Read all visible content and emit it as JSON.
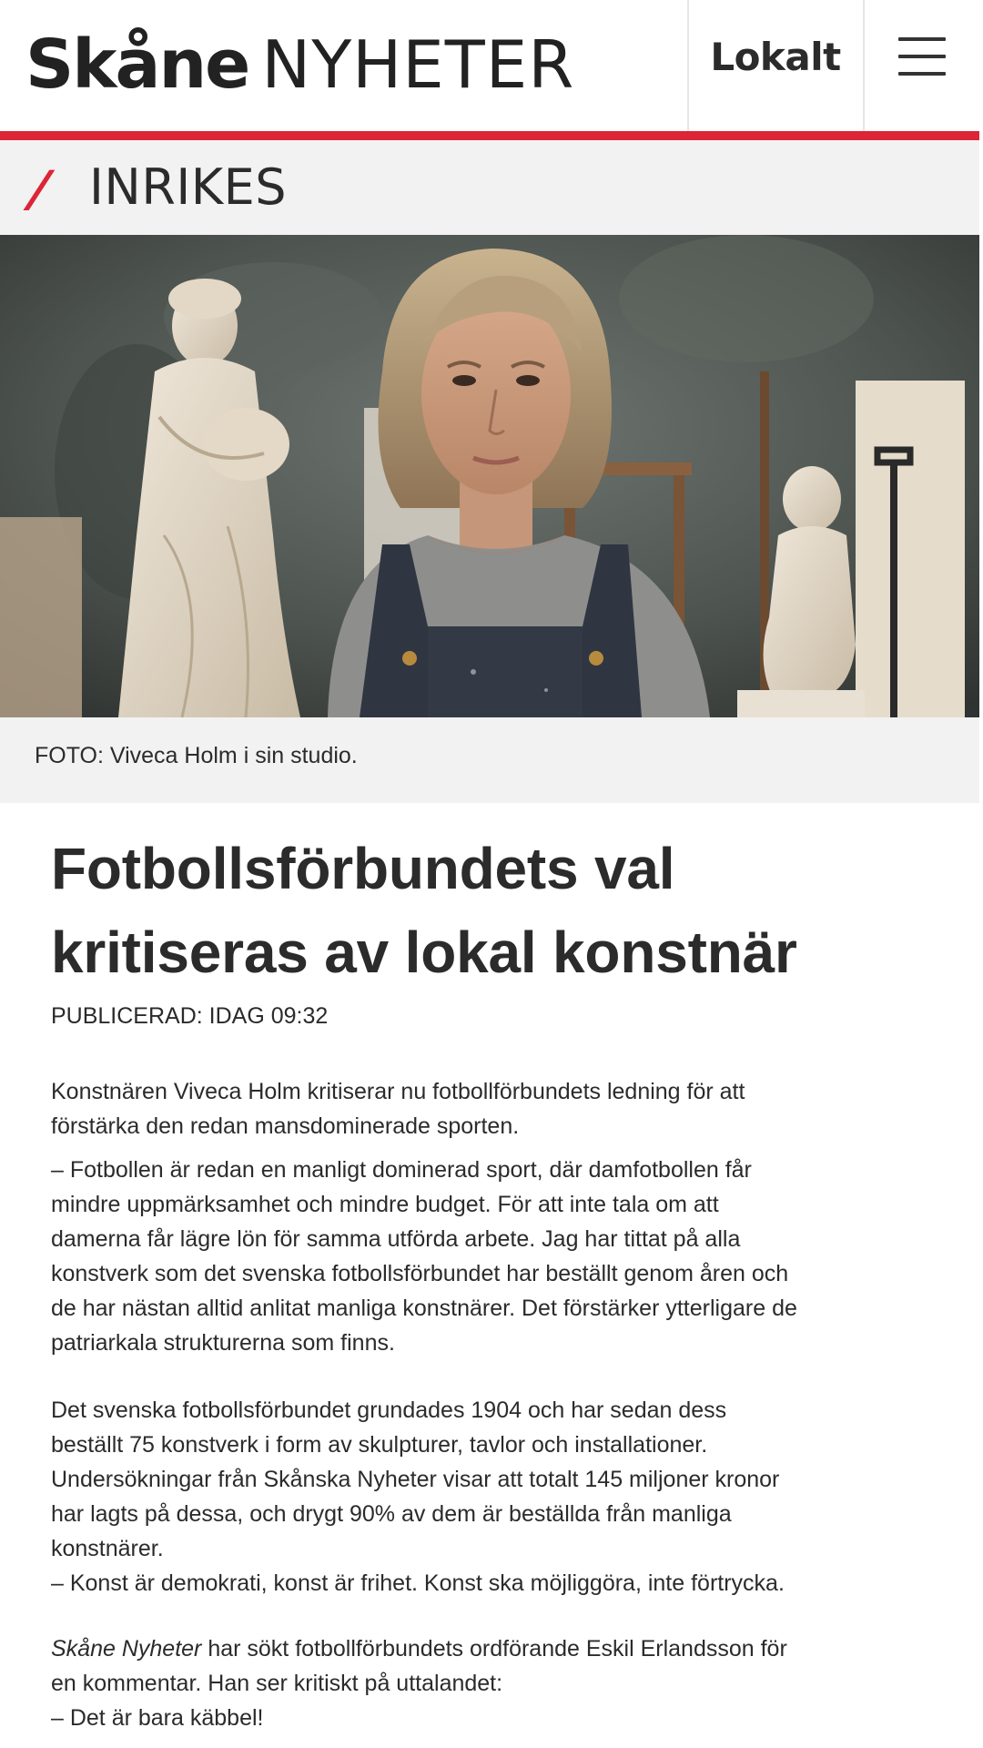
{
  "header": {
    "logo_bold": "Skåne",
    "logo_light": "NYHETER",
    "nav_lokalt": "Lokalt",
    "menu_icon": "hamburger-menu-icon"
  },
  "section": {
    "slash": "/",
    "title": "INRIKES"
  },
  "hero": {
    "image_description": "Portrait of a woman in overalls in a sculpture studio with marble statues"
  },
  "caption": "FOTO: Viveca Holm i sin studio.",
  "article": {
    "headline_line1": "Fotbollsförbundets val",
    "headline_line2": "kritiseras av lokal konstnär",
    "published": "PUBLICERAD: IDAG 09:32",
    "p1_line1": "Konstnären Viveca Holm kritiserar nu fotbollförbundets ledning för att",
    "p1_line2": "förstärka den redan mansdominerade sporten.",
    "p2_line1": "– Fotbollen är redan en manligt dominerad sport, där damfotbollen får",
    "p2_line2": "mindre uppmärksamhet och mindre budget. För att inte tala om att",
    "p2_line3": "damerna får lägre lön för samma utförda arbete. Jag har tittat på alla",
    "p2_line4": "konstverk som det svenska fotbollsförbundet har beställt genom åren och",
    "p2_line5": "de har nästan alltid anlitat manliga konstnärer. Det förstärker ytterligare de",
    "p2_line6": "patriarkala strukturerna som finns.",
    "p3_line1": "Det svenska fotbollsförbundet grundades 1904 och har sedan dess",
    "p3_line2": "beställt 75 konstverk i form av skulpturer, tavlor och installationer.",
    "p3_line3": "Undersökningar från Skånska Nyheter visar att totalt 145 miljoner kronor",
    "p3_line4": "har lagts på dessa, och drygt 90% av dem är beställda från manliga",
    "p3_line5": "konstnärer.",
    "p3_line6": "– Konst är demokrati, konst är frihet. Konst ska möjliggöra, inte förtrycka.",
    "p4_italic": "Skåne Nyheter",
    "p4_line1_rest": " har sökt fotbollförbundets ordförande Eskil Erlandsson för",
    "p4_line2": "en kommentar. Han ser kritiskt på uttalandet:",
    "p4_line3": "– Det är bara käbbel!"
  },
  "colors": {
    "accent_red": "#dc2536",
    "text": "#2b2b2b",
    "section_bg": "#f2f2f2"
  }
}
